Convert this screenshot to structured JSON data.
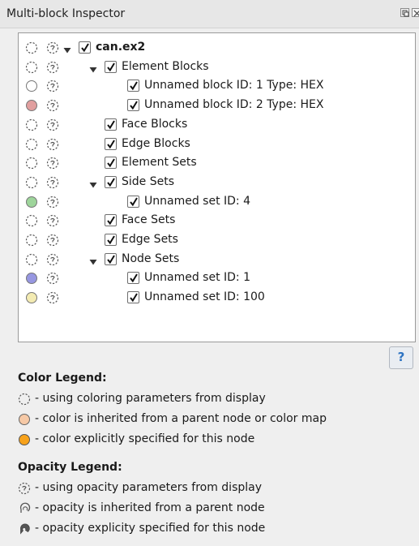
{
  "window": {
    "title": "Multi-block Inspector",
    "float_icon": "float-window-icon",
    "close_icon": "close-icon"
  },
  "tree": {
    "rows": [
      {
        "label": "can.ex2",
        "bold": true,
        "depth": 0,
        "expander": "expanded",
        "checked": true,
        "color_state": "display",
        "opacity_state": "display"
      },
      {
        "label": "Element Blocks",
        "bold": false,
        "depth": 1,
        "expander": "expanded",
        "checked": true,
        "color_state": "display",
        "opacity_state": "display"
      },
      {
        "label": "Unnamed block ID: 1 Type: HEX",
        "bold": false,
        "depth": 2,
        "expander": "none",
        "checked": true,
        "color_state": "explicit",
        "color": "#ffffff",
        "opacity_state": "display"
      },
      {
        "label": "Unnamed block ID: 2 Type: HEX",
        "bold": false,
        "depth": 2,
        "expander": "none",
        "checked": true,
        "color_state": "explicit",
        "color": "#e8a4a4",
        "opacity_state": "display"
      },
      {
        "label": "Face Blocks",
        "bold": false,
        "depth": 1,
        "expander": "none",
        "checked": true,
        "color_state": "display",
        "opacity_state": "display"
      },
      {
        "label": "Edge Blocks",
        "bold": false,
        "depth": 1,
        "expander": "none",
        "checked": true,
        "color_state": "display",
        "opacity_state": "display"
      },
      {
        "label": "Element Sets",
        "bold": false,
        "depth": 1,
        "expander": "none",
        "checked": true,
        "color_state": "display",
        "opacity_state": "display"
      },
      {
        "label": "Side Sets",
        "bold": false,
        "depth": 1,
        "expander": "expanded",
        "checked": true,
        "color_state": "display",
        "opacity_state": "display"
      },
      {
        "label": "Unnamed set ID: 4",
        "bold": false,
        "depth": 2,
        "expander": "none",
        "checked": true,
        "color_state": "explicit",
        "color": "#a3dca0",
        "opacity_state": "display"
      },
      {
        "label": "Face Sets",
        "bold": false,
        "depth": 1,
        "expander": "none",
        "checked": true,
        "color_state": "display",
        "opacity_state": "display"
      },
      {
        "label": "Edge Sets",
        "bold": false,
        "depth": 1,
        "expander": "none",
        "checked": true,
        "color_state": "display",
        "opacity_state": "display"
      },
      {
        "label": "Node Sets",
        "bold": false,
        "depth": 1,
        "expander": "expanded",
        "checked": true,
        "color_state": "display",
        "opacity_state": "display"
      },
      {
        "label": "Unnamed set ID: 1",
        "bold": false,
        "depth": 2,
        "expander": "none",
        "checked": true,
        "color_state": "explicit",
        "color": "#9c9ce8",
        "opacity_state": "display"
      },
      {
        "label": "Unnamed set ID: 100",
        "bold": false,
        "depth": 2,
        "expander": "none",
        "checked": true,
        "color_state": "explicit",
        "color": "#fbf2b8",
        "opacity_state": "display"
      }
    ]
  },
  "help_button": {
    "label": "?",
    "icon": "help-icon"
  },
  "color_legend": {
    "heading": "Color Legend:",
    "items": [
      {
        "icon": "color-display-icon",
        "text": "- using coloring parameters from display"
      },
      {
        "icon": "color-inherited-icon",
        "text": "- color is inherited from a parent node or color map",
        "color": "#f6c9a6"
      },
      {
        "icon": "color-explicit-icon",
        "text": "- color explicitly specified for this node",
        "color": "#f7a21b"
      }
    ]
  },
  "opacity_legend": {
    "heading": "Opacity Legend:",
    "items": [
      {
        "icon": "opacity-display-icon",
        "text": "- using opacity parameters from display"
      },
      {
        "icon": "opacity-inherited-icon",
        "text": "- opacity is inherited from a parent node"
      },
      {
        "icon": "opacity-explicit-icon",
        "text": "- opacity explicity specified for this node"
      }
    ]
  },
  "colors": {
    "checkmark": "#111111",
    "tree_background": "#ffffff",
    "panel_background": "#efefef",
    "help_glyph": "#2d73c2"
  }
}
